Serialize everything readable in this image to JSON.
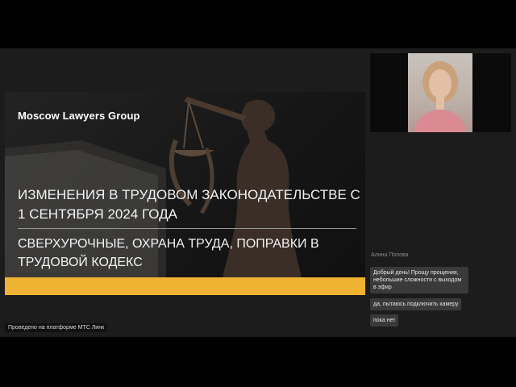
{
  "slide": {
    "brand": "Moscow Lawyers Group",
    "title": "ИЗМЕНЕНИЯ В ТРУДОВОМ ЗАКОНОДАТЕЛЬСТВЕ С 1 СЕНТЯБРЯ 2024 ГОДА",
    "subtitle": "СВЕРХУРОЧНЫЕ, ОХРАНА ТРУДА, ПОПРАВКИ В ТРУДОВОЙ КОДЕКС",
    "accent_color": "#f0b232"
  },
  "chat": {
    "author": "Алина Попова",
    "messages": [
      "Добрый день! Прощу прощения, небольшие сложности с выходом в эфир",
      "да, пытаюсь подключить камеру",
      "пока нет"
    ]
  },
  "footer": {
    "platform_label": "Проведено на платформе МТС Линк"
  },
  "icons": [
    "lady-justice-statue-image",
    "participant-video"
  ]
}
